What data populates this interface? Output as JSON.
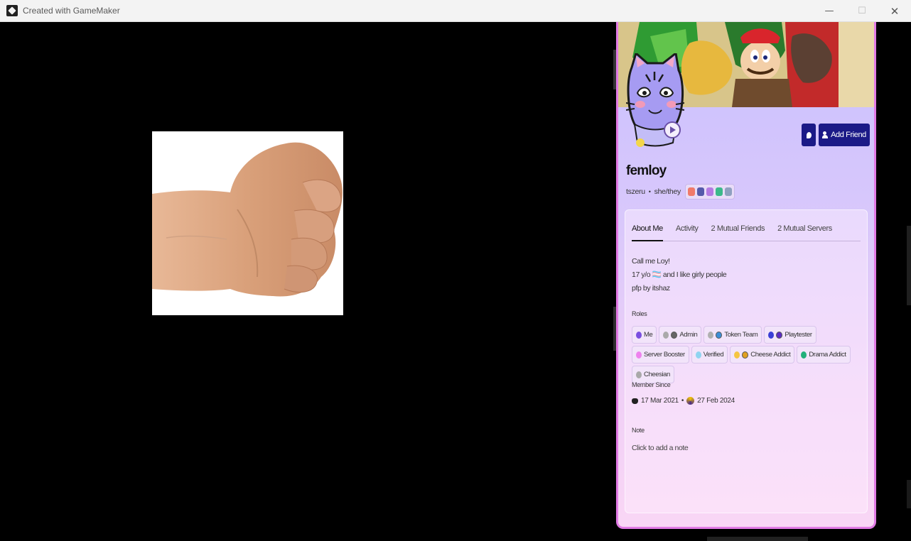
{
  "window": {
    "title": "Created with GameMaker",
    "minimize": "—",
    "maximize": "☐",
    "close": "✕"
  },
  "game": {
    "hand_image": "fist-image"
  },
  "profile": {
    "display_name": "femloy",
    "username": "tszeru",
    "separator": "•",
    "pronouns": "she/they",
    "add_friend_label": "Add Friend",
    "badges": [
      "#f07a6a",
      "#555aaa",
      "#b57be3",
      "#3cb98a",
      "#8fa0c0"
    ],
    "tabs": [
      "About Me",
      "Activity",
      "2 Mutual Friends",
      "2 Mutual Servers"
    ],
    "bio": {
      "line1": "Call me Loy!",
      "line2": "17 y/o 🏳️‍⚧️ and I like girly people",
      "line3": "pfp by itshaz"
    },
    "roles_heading": "Roles",
    "roles": [
      {
        "label": "Me",
        "color": "#7a4fe0"
      },
      {
        "label": "Admin",
        "color": "#aaaaaa"
      },
      {
        "label": "Token Team",
        "color": "#b0b0b0"
      },
      {
        "label": "Playtester",
        "color": "#3a3fd6"
      },
      {
        "label": "Server Booster",
        "color": "#ee82ee"
      },
      {
        "label": "Verified",
        "color": "#8fd4f0"
      },
      {
        "label": "Cheese Addict",
        "color": "#f5c542"
      },
      {
        "label": "Drama Addict",
        "color": "#21b07a"
      },
      {
        "label": "Cheesian",
        "color": "#a9a9a9"
      }
    ],
    "member_since_heading": "Member Since",
    "member_since_discord": "17 Mar 2021",
    "member_since_server": "27 Feb 2024",
    "note_heading": "Note",
    "note_placeholder": "Click to add a note"
  }
}
